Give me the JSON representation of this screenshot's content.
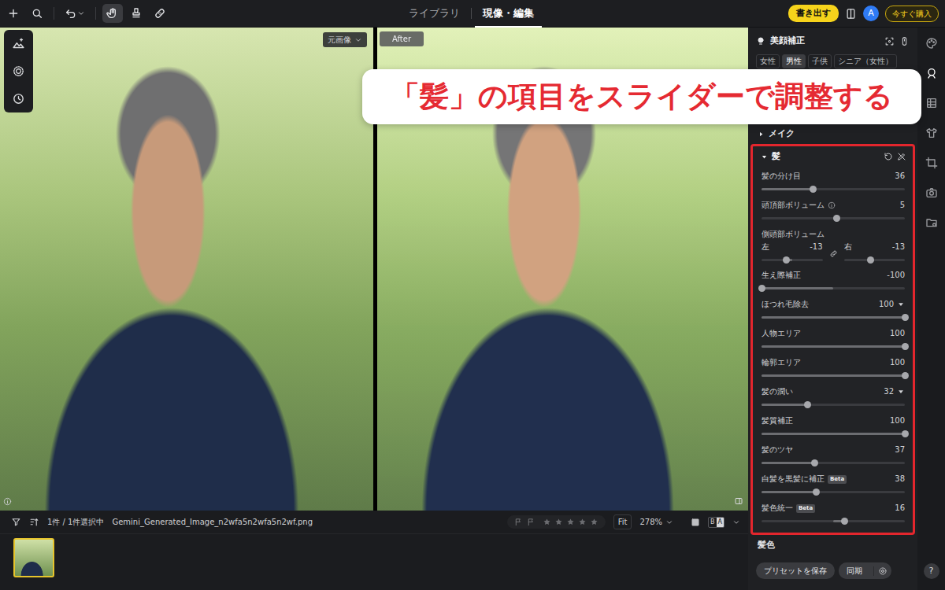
{
  "top_bar": {
    "tools": [
      {
        "kind": "add",
        "selected": false
      },
      {
        "kind": "search",
        "selected": false
      },
      {
        "kind": "undo",
        "selected": false
      },
      {
        "kind": "hand",
        "selected": true
      },
      {
        "kind": "stamp",
        "selected": false
      },
      {
        "kind": "heal",
        "selected": false
      }
    ],
    "tabs": [
      {
        "label": "ライブラリ",
        "selected": false
      },
      {
        "label": "現像・編集",
        "selected": true
      }
    ],
    "export_button": "書き出す",
    "avatar": "A",
    "buy_button": "今すぐ購入"
  },
  "left_tools": [
    {
      "kind": "auto"
    },
    {
      "kind": "texture"
    },
    {
      "kind": "history"
    }
  ],
  "viewer": {
    "before_label": "元画像",
    "after_label": "After"
  },
  "callout": "「髪」の項目をスライダーで調整する",
  "panel": {
    "title": "美顔補正",
    "tags": [
      {
        "label": "女性",
        "selected": false
      },
      {
        "label": "男性",
        "selected": true
      },
      {
        "label": "子供",
        "selected": false
      },
      {
        "label": "シニア（女性）",
        "selected": false
      }
    ],
    "makeup": {
      "label": "メイク",
      "expanded": false
    },
    "hair": {
      "label": "髪",
      "expanded": true,
      "rows": [
        {
          "kind": "slider",
          "label": "髪の分け目",
          "value": "36",
          "level": 0.36,
          "bipolar": false
        },
        {
          "kind": "slider",
          "label": "頭頂部ボリューム",
          "info": true,
          "value": "5",
          "level": 0.525,
          "bipolar": true
        },
        {
          "kind": "pair",
          "label": "側頭部ボリューム",
          "linked": true,
          "left": {
            "label": "左",
            "value": "-13",
            "level": 0.41,
            "bipolar": true
          },
          "right": {
            "label": "右",
            "value": "-13",
            "level": 0.44,
            "bipolar": true
          }
        },
        {
          "kind": "slider",
          "label": "生え際補正",
          "value": "-100",
          "level": 0,
          "bipolar": true
        },
        {
          "kind": "slider",
          "label": "ほつれ毛除去",
          "value": "100",
          "level": 1,
          "bipolar": false,
          "expanded": true
        },
        {
          "kind": "slider",
          "label": "人物エリア",
          "value": "100",
          "level": 1,
          "bipolar": false
        },
        {
          "kind": "slider",
          "label": "輪郭エリア",
          "value": "100",
          "level": 1,
          "bipolar": false
        },
        {
          "kind": "slider",
          "label": "髪の潤い",
          "value": "32",
          "level": 0.32,
          "bipolar": false,
          "expanded": true
        },
        {
          "kind": "slider",
          "label": "髪質補正",
          "value": "100",
          "level": 1,
          "bipolar": false
        },
        {
          "kind": "slider",
          "label": "髪のツヤ",
          "value": "37",
          "level": 0.37,
          "bipolar": false
        },
        {
          "kind": "slider",
          "label": "白髪を黒髪に補正",
          "badge": "Beta",
          "value": "38",
          "level": 0.38,
          "bipolar": false
        },
        {
          "kind": "slider",
          "label": "髪色統一",
          "badge": "Beta",
          "value": "16",
          "level": 0.58,
          "bipolar": true
        }
      ]
    },
    "next_section": "髪色",
    "save_preset": "プリセットを保存",
    "sync": "同期"
  },
  "rail": [
    {
      "kind": "palette",
      "selected": false
    },
    {
      "kind": "face",
      "selected": true
    },
    {
      "kind": "grid",
      "selected": false
    },
    {
      "kind": "shirt",
      "selected": false
    },
    {
      "kind": "crop",
      "selected": false
    },
    {
      "kind": "camera",
      "selected": false
    },
    {
      "kind": "folder",
      "selected": false
    }
  ],
  "help": "?",
  "filmstrip": {
    "count": "1件 / 1件選択中",
    "filename": "Gemini_Generated_Image_n2wfa5n2wfa5n2wf.png",
    "stars": 0,
    "fit": "Fit",
    "zoom": "278%",
    "compare": {
      "before": "B",
      "after": "A",
      "selected": true
    },
    "thumbnails": [
      {
        "selected": true
      }
    ]
  }
}
